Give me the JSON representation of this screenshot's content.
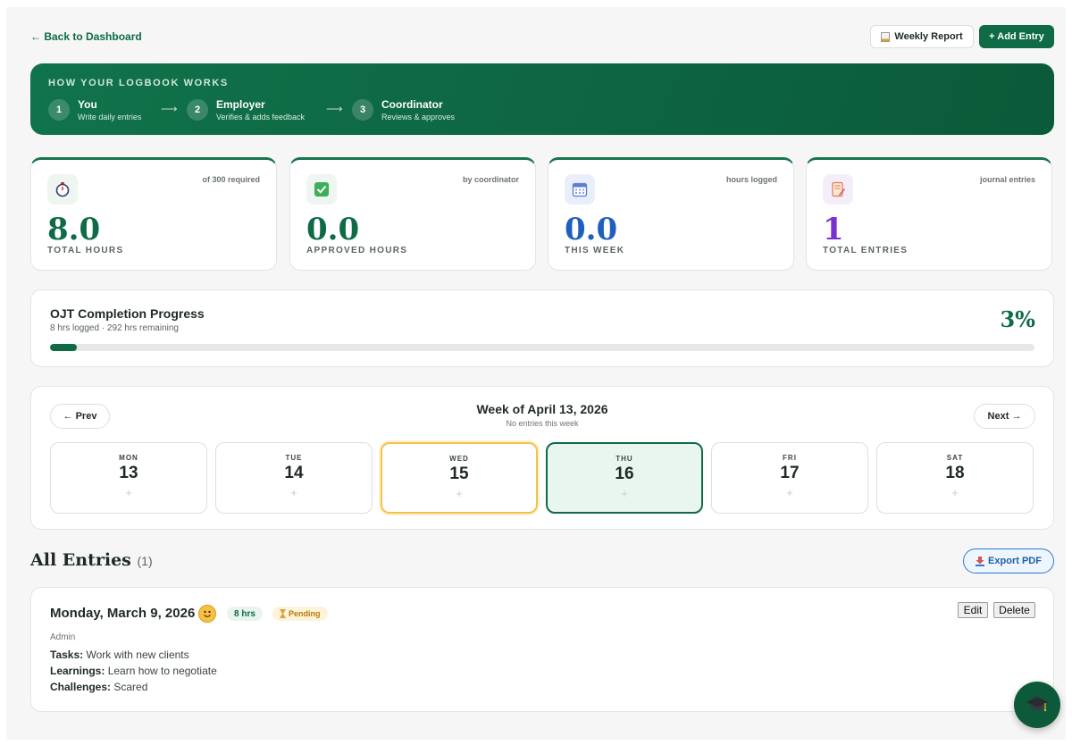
{
  "topbar": {
    "back_label": "← Back to Dashboard",
    "weekly_report_label": "Weekly Report",
    "add_entry_label": "+ Add Entry"
  },
  "banner": {
    "title": "HOW YOUR LOGBOOK WORKS",
    "arrow": "⟶",
    "steps": [
      {
        "num": "1",
        "name": "You",
        "desc": "Write daily entries"
      },
      {
        "num": "2",
        "name": "Employer",
        "desc": "Verifies & adds feedback"
      },
      {
        "num": "3",
        "name": "Coordinator",
        "desc": "Reviews & approves"
      }
    ]
  },
  "stats": [
    {
      "icon": "stopwatch-icon",
      "caption": "of 300 required",
      "value": "8.0",
      "label": "TOTAL HOURS",
      "color": "#0e6b45"
    },
    {
      "icon": "check-box-icon",
      "caption": "by coordinator",
      "value": "0.0",
      "label": "APPROVED HOURS",
      "color": "#0e6b45"
    },
    {
      "icon": "calendar-icon",
      "caption": "hours logged",
      "value": "0.0",
      "label": "THIS WEEK",
      "color": "#1f5fbf"
    },
    {
      "icon": "journal-icon",
      "caption": "journal entries",
      "value": "1",
      "label": "TOTAL ENTRIES",
      "color": "#7b2fd0"
    }
  ],
  "progress": {
    "title": "OJT Completion Progress",
    "subtitle": "8 hrs logged · 292 hrs remaining",
    "percent_label": "3%",
    "fraction": 0.027
  },
  "week": {
    "prev_label": "← Prev",
    "next_label": "Next →",
    "title": "Week of April 13, 2026",
    "subtitle": "No entries this week",
    "days": [
      {
        "name": "MON",
        "num": "13",
        "plus": "+"
      },
      {
        "name": "TUE",
        "num": "14",
        "plus": "+"
      },
      {
        "name": "WED",
        "num": "15",
        "plus": "+"
      },
      {
        "name": "THU",
        "num": "16",
        "plus": "+"
      },
      {
        "name": "FRI",
        "num": "17",
        "plus": "+"
      },
      {
        "name": "SAT",
        "num": "18",
        "plus": "+"
      }
    ]
  },
  "entries": {
    "heading": "All Entries",
    "count": "(1)",
    "export_label": "Export PDF",
    "items": [
      {
        "date": "Monday, March 9, 2026",
        "mood": "smiling-face-icon",
        "hours": "8 hrs",
        "status": "Pending",
        "edit_label": "Edit",
        "delete_label": "Delete",
        "author": "Admin",
        "tasks_label": "Tasks:",
        "tasks": "Work with new clients",
        "learnings_label": "Learnings:",
        "learnings": "Learn how to negotiate",
        "challenges_label": "Challenges:",
        "challenges": "Scared"
      }
    ]
  },
  "fab": {
    "icon": "graduation-cap-icon"
  }
}
